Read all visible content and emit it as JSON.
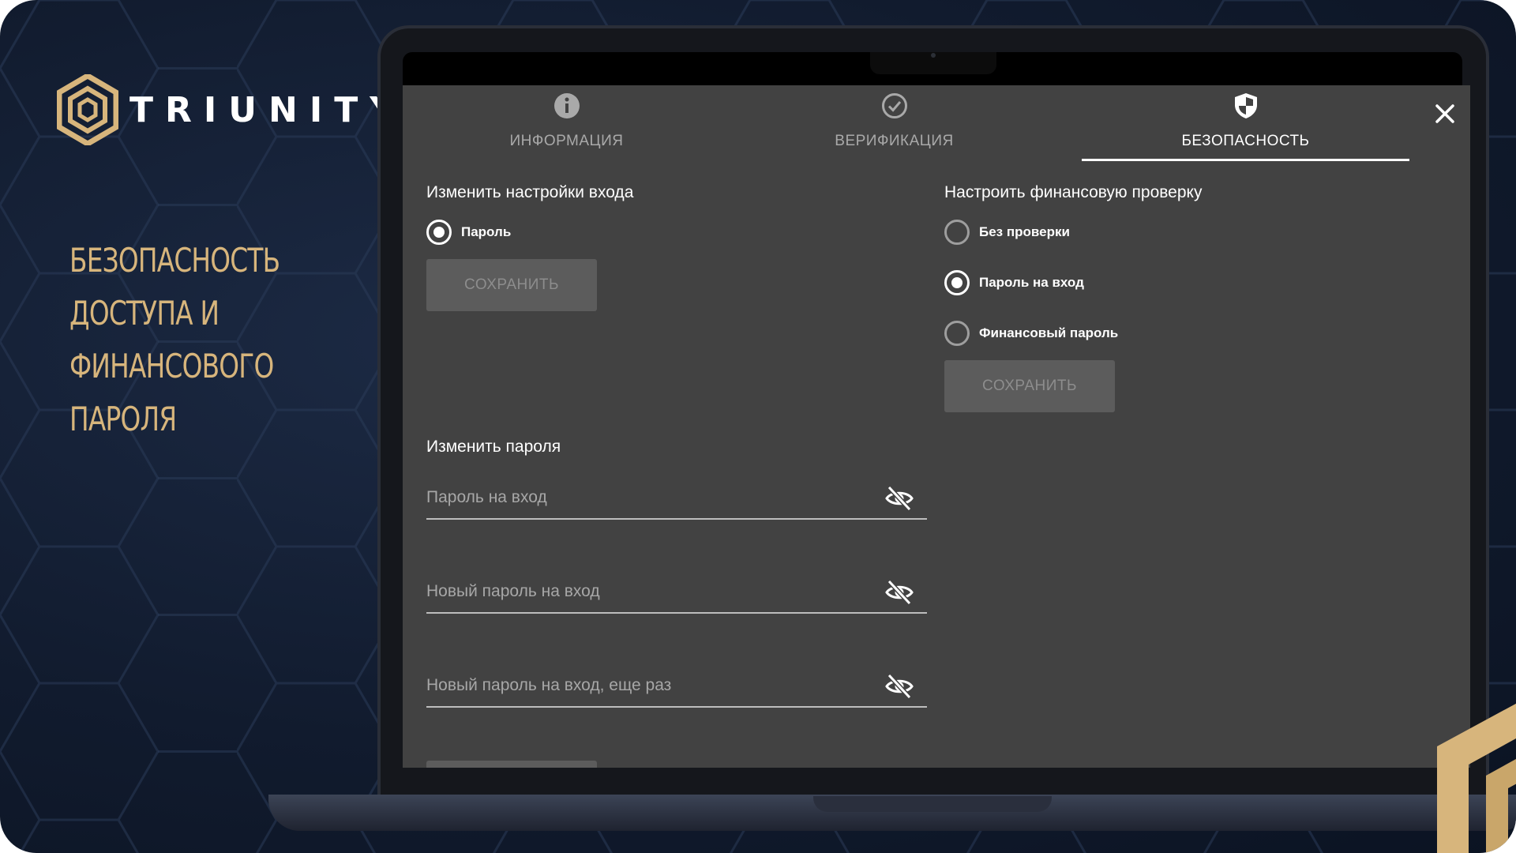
{
  "brand": {
    "name": "TRIUNITY",
    "logo_icon": "hexagon-logo-icon"
  },
  "headline": {
    "lines": [
      "БЕЗОПАСНОСТЬ",
      "ДОСТУПА И",
      "ФИНАНСОВОГО",
      "ПАРОЛЯ"
    ]
  },
  "tabs": [
    {
      "label": "ИНФОРМАЦИЯ",
      "icon": "info-icon",
      "active": false
    },
    {
      "label": "ВЕРИФИКАЦИЯ",
      "icon": "check-circle-icon",
      "active": false
    },
    {
      "label": "БЕЗОПАСНОСТЬ",
      "icon": "shield-icon",
      "active": true
    }
  ],
  "login_settings": {
    "title": "Изменить настройки входа",
    "options": [
      {
        "label": "Пароль",
        "checked": true
      }
    ],
    "save_label": "СОХРАНИТЬ"
  },
  "finance_check": {
    "title": "Настроить финансовую проверку",
    "options": [
      {
        "label": "Без проверки",
        "checked": false
      },
      {
        "label": "Пароль на вход",
        "checked": true
      },
      {
        "label": "Финансовый пароль",
        "checked": false
      }
    ],
    "save_label": "СОХРАНИТЬ"
  },
  "change_password": {
    "title": "Изменить пароля",
    "fields": [
      {
        "placeholder": "Пароль на вход",
        "value": ""
      },
      {
        "placeholder": "Новый пароль на вход",
        "value": ""
      },
      {
        "placeholder": "Новый пароль на вход, еще раз",
        "value": ""
      }
    ]
  },
  "colors": {
    "accent_gold": "#d7b57c",
    "screen_bg": "#424242",
    "button_bg": "#5c5c5c",
    "background": "#111b2e"
  }
}
